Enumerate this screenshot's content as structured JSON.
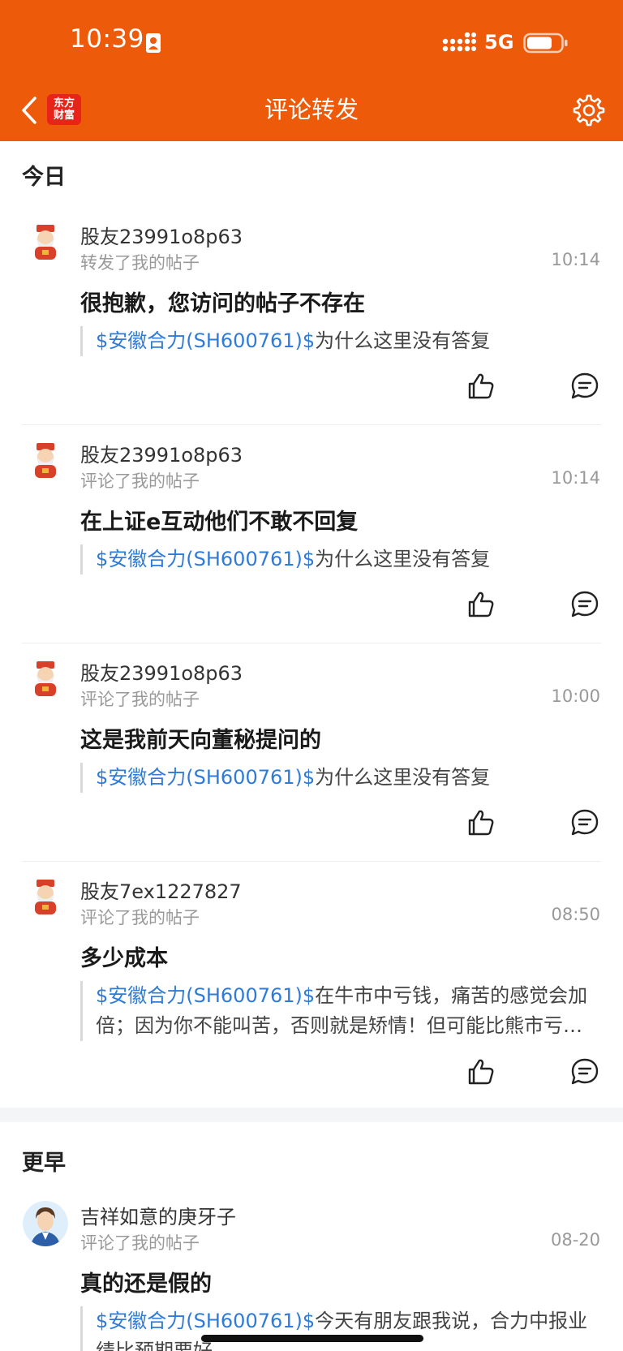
{
  "status_bar": {
    "time": "10:39",
    "network": "5G"
  },
  "header": {
    "logo_line1": "东方",
    "logo_line2": "财富",
    "title": "评论转发"
  },
  "sections": [
    {
      "label": "今日",
      "items": [
        {
          "name": "股友23991o8p63",
          "action": "转发了我的帖子",
          "time": "10:14",
          "content": "很抱歉，您访问的帖子不存在",
          "quote_tag": "$安徽合力(SH600761)$",
          "quote_text": "为什么这里没有答复"
        },
        {
          "name": "股友23991o8p63",
          "action": "评论了我的帖子",
          "time": "10:14",
          "content": "在上证e互动他们不敢不回复",
          "quote_tag": "$安徽合力(SH600761)$",
          "quote_text": "为什么这里没有答复"
        },
        {
          "name": "股友23991o8p63",
          "action": "评论了我的帖子",
          "time": "10:00",
          "content": "这是我前天向董秘提问的",
          "quote_tag": "$安徽合力(SH600761)$",
          "quote_text": "为什么这里没有答复"
        },
        {
          "name": "股友7ex1227827",
          "action": "评论了我的帖子",
          "time": "08:50",
          "content": "多少成本",
          "quote_tag": "$安徽合力(SH600761)$",
          "quote_text": "在牛市中亏钱，痛苦的感觉会加倍；因为你不能叫苦，否则就是矫情！但可能比熊市亏损更难受..."
        }
      ]
    },
    {
      "label": "更早",
      "items": [
        {
          "name": "吉祥如意的庚牙子",
          "action": "评论了我的帖子",
          "time": "08-20",
          "content": "真的还是假的",
          "quote_tag": "$安徽合力(SH600761)$",
          "quote_text": "今天有朋友跟我说，合力中报业绩比预期要好"
        }
      ]
    }
  ],
  "colors": {
    "header_bg": "#ec5a0a",
    "stock_tag": "#2f7bd6"
  }
}
